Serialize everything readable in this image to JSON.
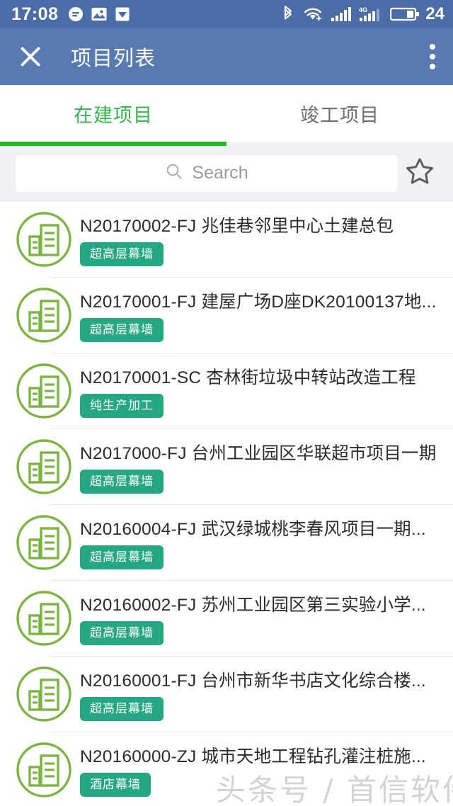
{
  "statusbar": {
    "time": "17:08",
    "battery_level": "24",
    "left_icons": [
      "message-icon",
      "photo-icon",
      "download-icon"
    ],
    "right_icons": [
      "bluetooth-icon",
      "wifi-icon",
      "signal-icon",
      "signal-4g-icon",
      "battery-icon"
    ]
  },
  "appbar": {
    "close_icon": "close-icon",
    "title": "项目列表",
    "overflow_icon": "overflow-menu-icon",
    "background": "#577ab2"
  },
  "tabs": [
    {
      "label": "在建项目",
      "active": true
    },
    {
      "label": "竣工项目",
      "active": false
    }
  ],
  "tab_accent": "#1fbf1f",
  "search": {
    "placeholder": "Search",
    "value": "",
    "icon": "search-icon",
    "favorite_icon": "star-icon"
  },
  "badge_color": "#26a783",
  "list": [
    {
      "title": "N20170002-FJ 兆佳巷邻里中心土建总包",
      "badge": "超高层幕墙"
    },
    {
      "title": "N20170001-FJ 建屋广场D座DK20100137地...",
      "badge": "超高层幕墙"
    },
    {
      "title": "N20170001-SC 杏林街垃圾中转站改造工程",
      "badge": "纯生产加工"
    },
    {
      "title": "N2017000-FJ 台州工业园区华联超市项目一期",
      "badge": "超高层幕墙"
    },
    {
      "title": "N20160004-FJ 武汉绿城桃李春风项目一期...",
      "badge": "超高层幕墙"
    },
    {
      "title": "N20160002-FJ 苏州工业园区第三实验小学...",
      "badge": "超高层幕墙"
    },
    {
      "title": "N20160001-FJ 台州市新华书店文化综合楼...",
      "badge": "超高层幕墙"
    },
    {
      "title": "N20160000-ZJ 城市天地工程钻孔灌注桩施...",
      "badge": "酒店幕墙"
    }
  ],
  "watermark": "头条号 / 首信软件"
}
